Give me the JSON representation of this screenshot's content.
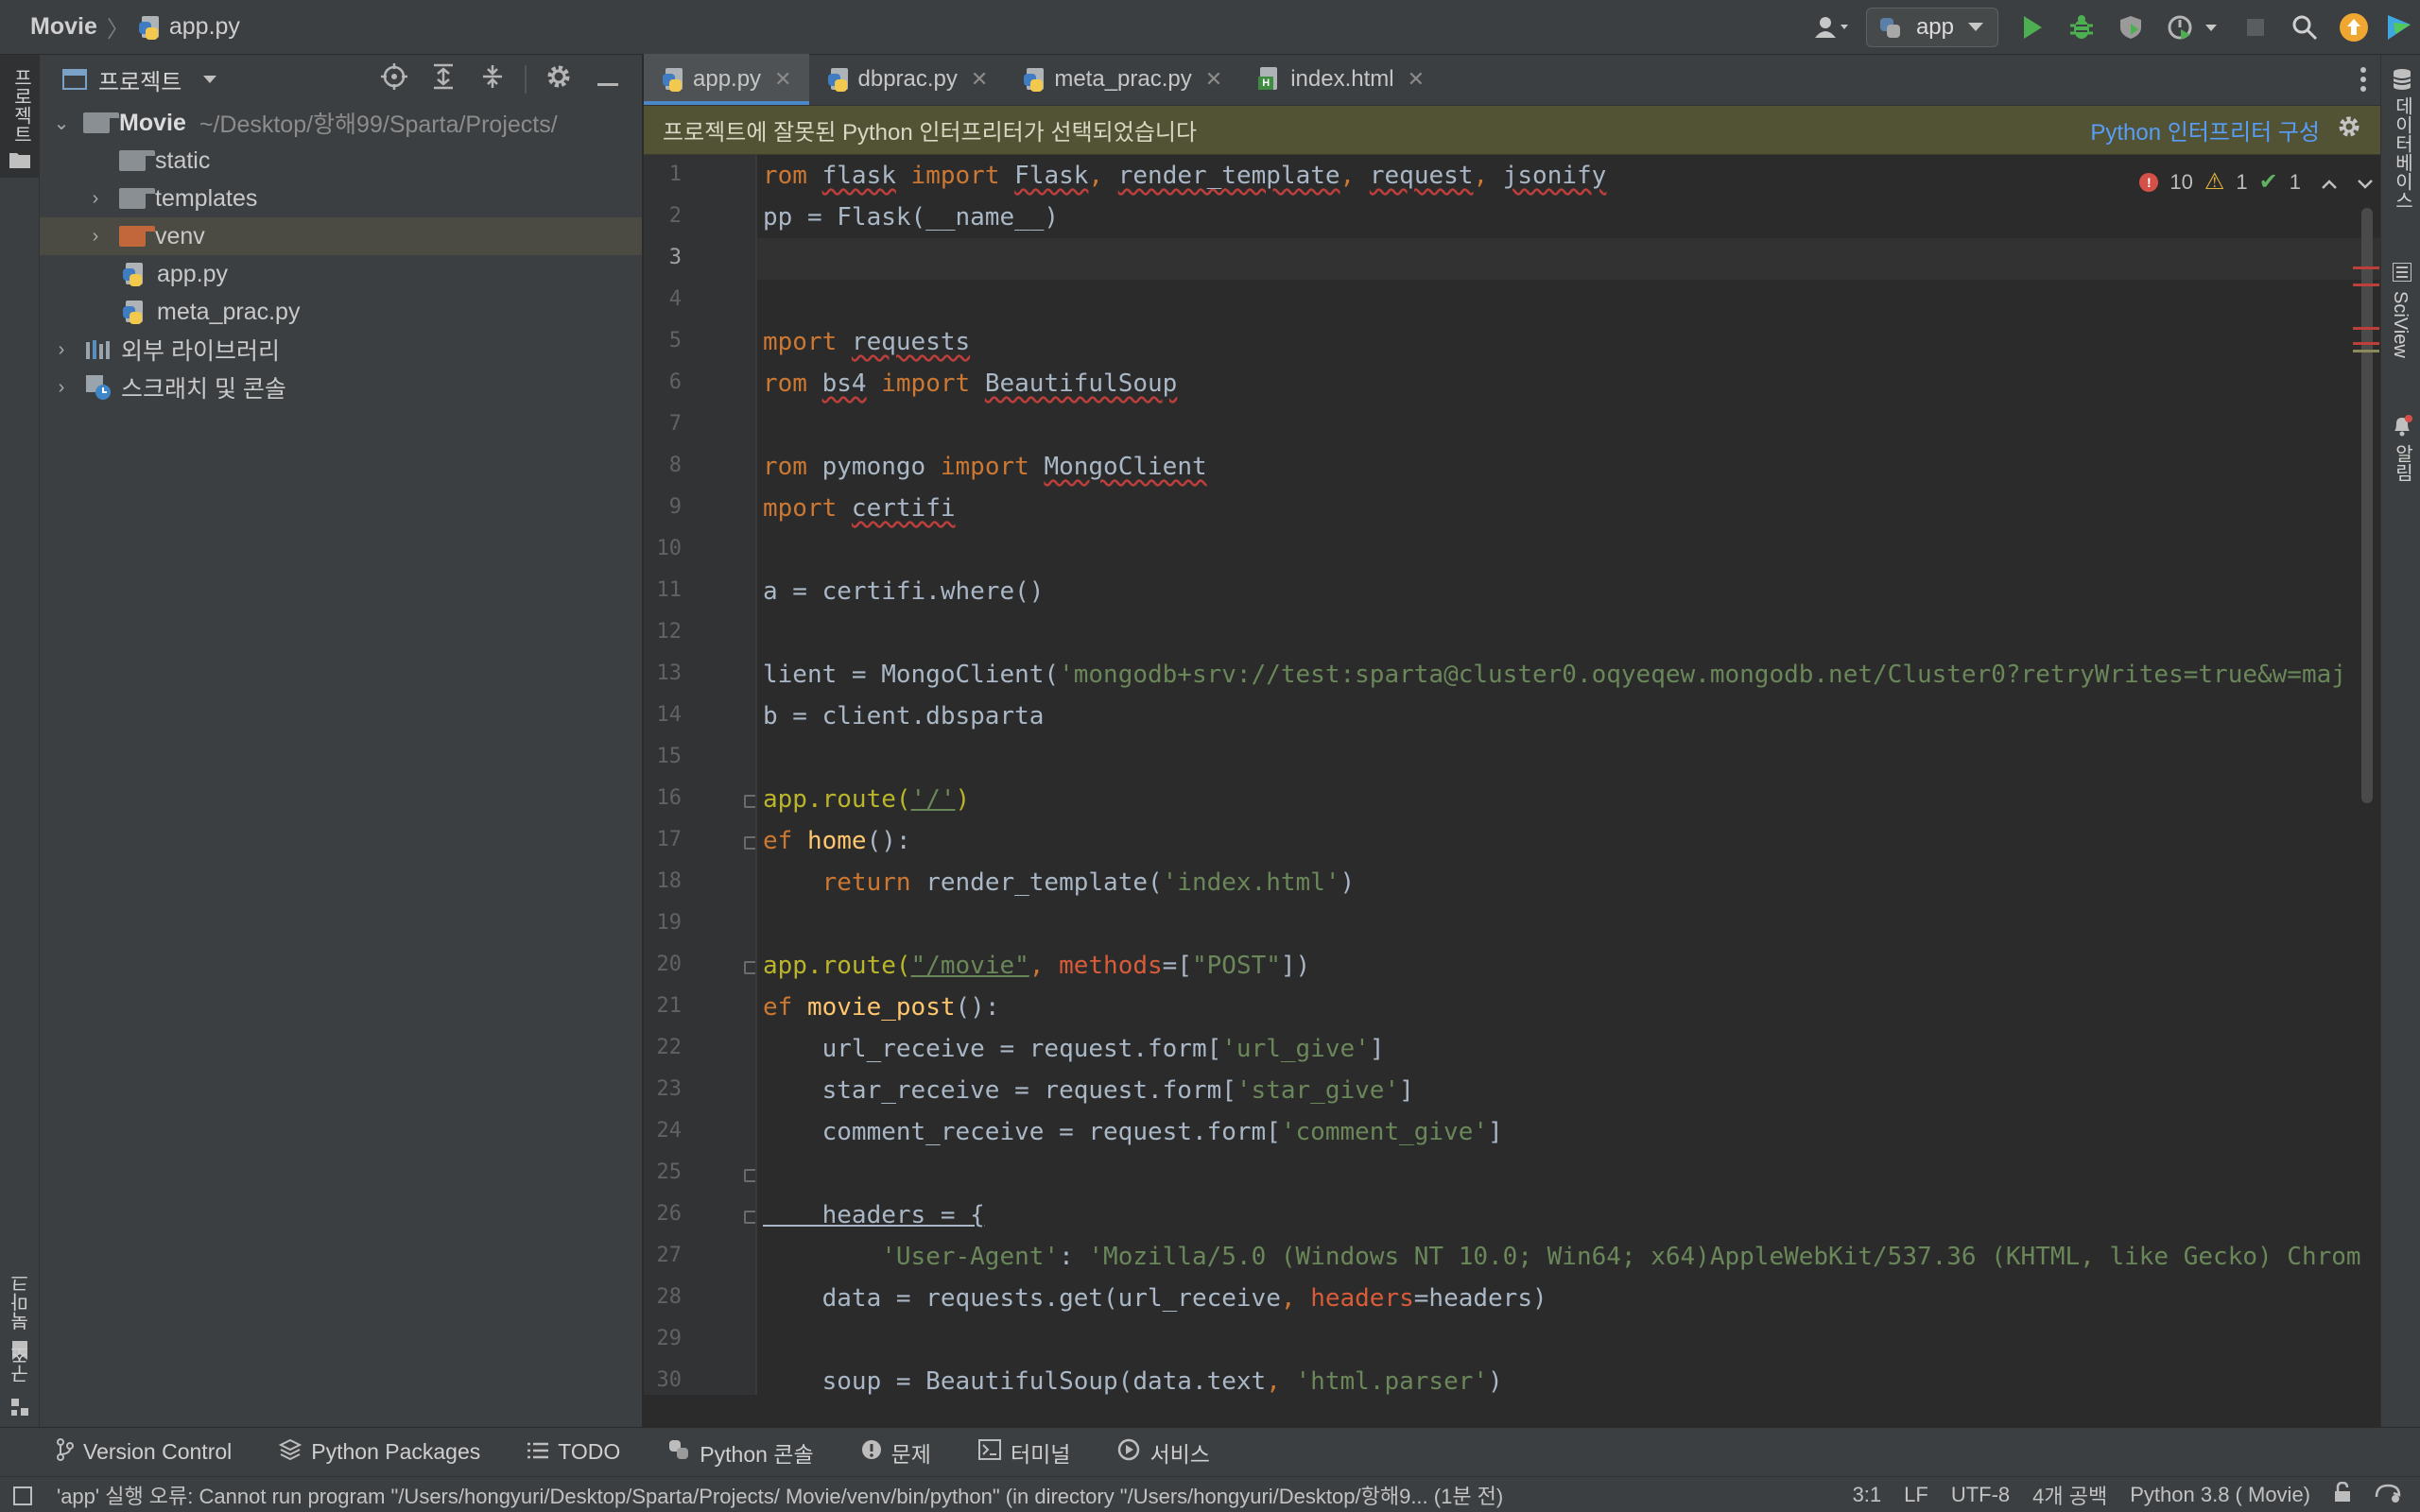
{
  "titlebar": {
    "project_name": "Movie",
    "file_name": "app.py",
    "run_config": "app"
  },
  "left_strip": {
    "project_label": "프로젝트",
    "bookmarks_label": "북마크",
    "structure_label": "구조"
  },
  "right_strip": {
    "database_label": "데이터베이스",
    "sciview_label": "SciView",
    "notifications_label": "알림"
  },
  "project_panel": {
    "title": "프로젝트",
    "root_name": "Movie",
    "root_path": "~/Desktop/항해99/Sparta/Projects/",
    "items": [
      {
        "label": "static"
      },
      {
        "label": "templates"
      },
      {
        "label": "venv"
      },
      {
        "label": "app.py"
      },
      {
        "label": "meta_prac.py"
      },
      {
        "label": "외부 라이브러리"
      },
      {
        "label": "스크래치 및 콘솔"
      }
    ]
  },
  "tabs": [
    {
      "label": "app.py"
    },
    {
      "label": "dbprac.py"
    },
    {
      "label": "meta_prac.py"
    },
    {
      "label": "index.html"
    }
  ],
  "banner": {
    "message": "프로젝트에 잘못된 Python 인터프리터가 선택되었습니다",
    "link": "Python 인터프리터 구성"
  },
  "inspections": {
    "errors": "10",
    "warnings": "1",
    "typos": "1"
  },
  "line_numbers": [
    "1",
    "2",
    "3",
    "4",
    "5",
    "6",
    "7",
    "8",
    "9",
    "10",
    "11",
    "12",
    "13",
    "14",
    "15",
    "16",
    "17",
    "18",
    "19",
    "20",
    "21",
    "22",
    "23",
    "24",
    "25",
    "26",
    "27",
    "28",
    "29",
    "30"
  ],
  "code": {
    "l1": [
      "rom ",
      "flask",
      " import ",
      "Flask",
      ", ",
      "render_template",
      ", ",
      "request",
      ", ",
      "jsonify"
    ],
    "l2": "pp = Flask(__name__)",
    "l4": [
      "mport ",
      "requests"
    ],
    "l5": [
      "rom ",
      "bs4",
      " import ",
      "BeautifulSoup"
    ],
    "l7": [
      "rom ",
      "pymongo",
      " import ",
      "MongoClient"
    ],
    "l8": [
      "mport ",
      "certifi"
    ],
    "l10": "a = certifi.where()",
    "l12": [
      "lient = MongoClient(",
      "'mongodb+srv://test:sparta@cluster0.oqyeqew.mongodb.net/Cluster0?retryWrites=true&w=maj"
    ],
    "l13": "b = client.dbsparta",
    "l15": [
      "app.route(",
      "'/'",
      ")"
    ],
    "l16": [
      "ef ",
      "home",
      "():"
    ],
    "l17": [
      "    ",
      "return ",
      "render_template(",
      "'index.html'",
      ")"
    ],
    "l19": [
      "app.route(",
      "\"/movie\"",
      ", ",
      "methods",
      "=[",
      "\"POST\"",
      "])"
    ],
    "l20": [
      "ef ",
      "movie_post",
      "():"
    ],
    "l21": [
      "    url_receive = request.form[",
      "'url_give'",
      "]"
    ],
    "l22": [
      "    star_receive = request.form[",
      "'star_give'",
      "]"
    ],
    "l23": [
      "    comment_receive = request.form[",
      "'comment_give'",
      "]"
    ],
    "l25": "    headers = {",
    "l26": [
      "        ",
      "'User-Agent'",
      ": ",
      "'Mozilla/5.0 (Windows NT 10.0; Win64; x64)AppleWebKit/537.36 (KHTML, like Gecko) Chrom"
    ],
    "l27": [
      "    data = requests.get(url_receive",
      ", ",
      "headers",
      "=headers)"
    ],
    "l29": [
      "    soup = BeautifulSoup(data.text",
      ", ",
      "'html.parser'",
      ")"
    ]
  },
  "tool_windows": [
    {
      "label": "Version Control"
    },
    {
      "label": "Python Packages"
    },
    {
      "label": "TODO"
    },
    {
      "label": "Python 콘솔"
    },
    {
      "label": "문제"
    },
    {
      "label": "터미널"
    },
    {
      "label": "서비스"
    }
  ],
  "status": {
    "message": "'app' 실행 오류: Cannot run program \"/Users/hongyuri/Desktop/Sparta/Projects/ Movie/venv/bin/python\" (in directory \"/Users/hongyuri/Desktop/항해9... (1분 전)",
    "position": "3:1",
    "line_sep": "LF",
    "encoding": "UTF-8",
    "indent": "4개 공백",
    "interpreter": "Python 3.8 ( Movie)"
  },
  "colors": {
    "keyword": "#cc7832",
    "string": "#6a8759",
    "function": "#ffc66d",
    "decorator": "#bbb529",
    "link": "#589df6",
    "banner_bg": "#525235"
  }
}
